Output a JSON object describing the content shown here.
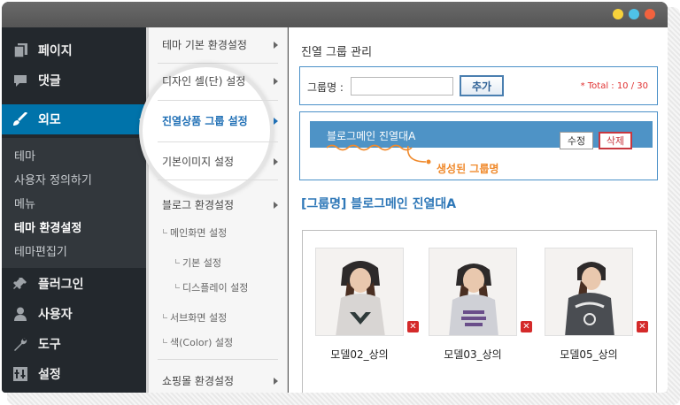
{
  "sidebar": {
    "items": [
      {
        "label": "페이지",
        "icon": "pages-icon"
      },
      {
        "label": "댓글",
        "icon": "comments-icon"
      },
      {
        "label": "외모",
        "icon": "appearance-icon"
      },
      {
        "label": "플러그인",
        "icon": "plugins-icon"
      },
      {
        "label": "사용자",
        "icon": "users-icon"
      },
      {
        "label": "도구",
        "icon": "tools-icon"
      },
      {
        "label": "설정",
        "icon": "settings-icon"
      }
    ],
    "submenu": [
      "테마",
      "사용자 정의하기",
      "메뉴",
      "테마 환경설정",
      "테마편집기"
    ]
  },
  "theme_panel": {
    "items": [
      "테마 기본 환경설정",
      "디자인 셀(단) 설정",
      "진열상품 그룹 설정",
      "기본이미지 설정",
      "블로그 환경설정",
      "쇼핑몰 환경설정"
    ],
    "sub_items": [
      "메인화면 설정",
      "기본 설정",
      "디스플레이 설정",
      "서브화면 설정",
      "색(Color) 설정"
    ]
  },
  "main": {
    "title": "진열 그룹 관리",
    "group_label": "그룹명 :",
    "group_input_value": "",
    "add_button": "추가",
    "total": "* Total : 10 / 30",
    "group_bar_name": "블로그메인 진열대A",
    "edit_button": "수정",
    "delete_button": "삭제",
    "callout": "생성된 그룹명",
    "section_title": "[그룹명] 블로그메인 진열대A",
    "products": [
      {
        "name": "모델02_상의",
        "delete": "✕"
      },
      {
        "name": "모델03_상의",
        "delete": "✕"
      },
      {
        "name": "모델05_상의",
        "delete": "✕"
      }
    ]
  },
  "colors": {
    "wp_sidebar": "#23282d",
    "wp_active": "#0073aa",
    "accent_blue": "#4e93c6",
    "total_red": "#e03030",
    "callout_orange": "#f08a2c",
    "delete_red": "#d42a2a"
  }
}
